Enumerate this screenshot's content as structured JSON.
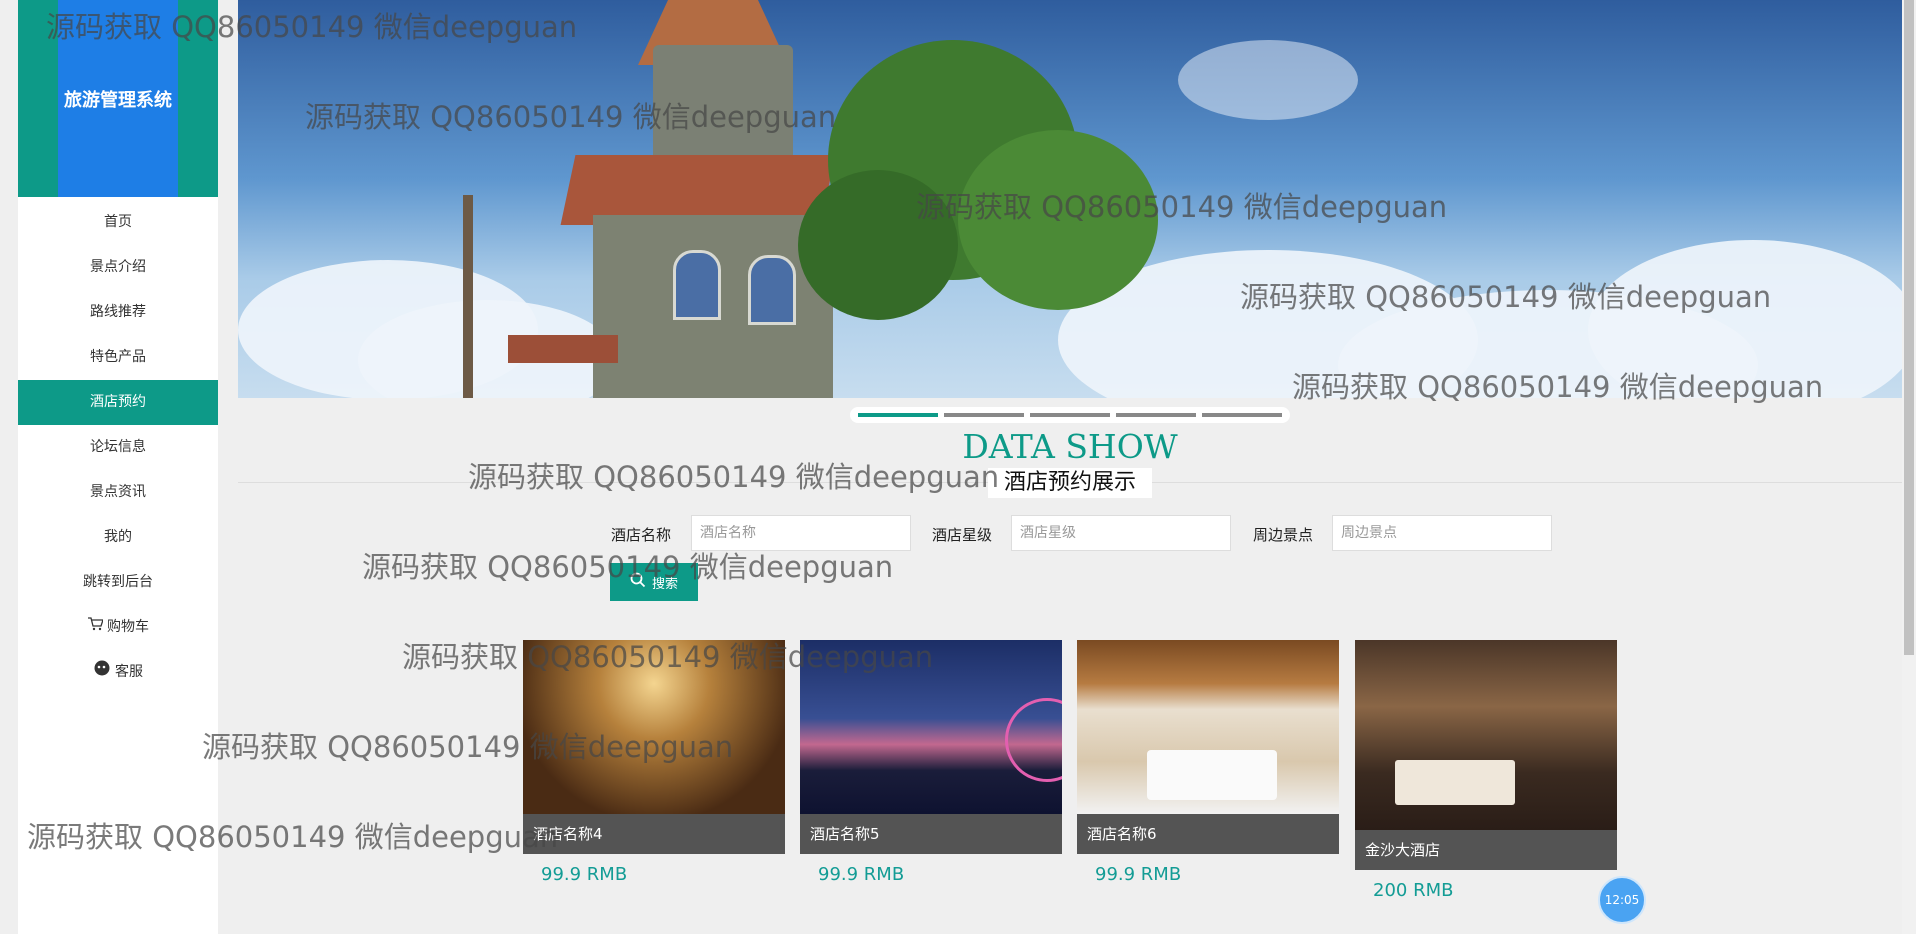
{
  "sidebar": {
    "title": "旅游管理系统",
    "items": [
      {
        "label": "首页"
      },
      {
        "label": "景点介绍"
      },
      {
        "label": "路线推荐"
      },
      {
        "label": "特色产品"
      },
      {
        "label": "酒店预约"
      },
      {
        "label": "论坛信息"
      },
      {
        "label": "景点资讯"
      },
      {
        "label": "我的"
      },
      {
        "label": "跳转到后台"
      },
      {
        "label": "购物车",
        "icon": "cart-icon"
      },
      {
        "label": "客服",
        "icon": "chat-icon"
      }
    ],
    "active_index": 4
  },
  "banner": {
    "active_slide": 1,
    "slide_count": 5
  },
  "heading": {
    "title": "DATA SHOW",
    "subtitle": "酒店预约展示"
  },
  "search": {
    "fields": [
      {
        "label": "酒店名称",
        "placeholder": "酒店名称",
        "value": ""
      },
      {
        "label": "酒店星级",
        "placeholder": "酒店星级",
        "value": ""
      },
      {
        "label": "周边景点",
        "placeholder": "周边景点",
        "value": ""
      }
    ],
    "button_label": "搜索",
    "button_icon": "search-icon"
  },
  "hotels": [
    {
      "name": "酒店名称4",
      "price": "99.9 RMB"
    },
    {
      "name": "酒店名称5",
      "price": "99.9 RMB"
    },
    {
      "name": "酒店名称6",
      "price": "99.9 RMB"
    },
    {
      "name": "金沙大酒店",
      "price": "200 RMB"
    }
  ],
  "watermark": "源码获取 QQ86050149 微信deepguan",
  "clock": "12:05",
  "colors": {
    "accent": "#0d9a88",
    "logo_blue": "#1e7ee6",
    "price": "#139c95"
  }
}
